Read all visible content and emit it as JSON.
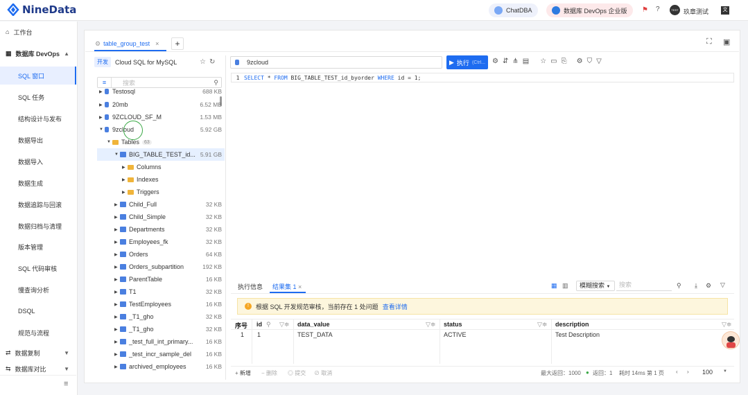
{
  "app": {
    "logo": "NineData",
    "chatdba": "ChatDBA",
    "devops_pill": "数据库 DevOps 企业版",
    "user_name": "玖章测试",
    "user_badge": "TEST"
  },
  "sidebar": {
    "items": [
      {
        "label": "工作台"
      },
      {
        "label": "数据库 DevOps"
      },
      {
        "label": "SQL 窗口"
      },
      {
        "label": "SQL 任务"
      },
      {
        "label": "结构设计与发布"
      },
      {
        "label": "数据导出"
      },
      {
        "label": "数据导入"
      },
      {
        "label": "数据生成"
      },
      {
        "label": "数据追踪与回滚"
      },
      {
        "label": "数据归档与清理"
      },
      {
        "label": "版本管理"
      },
      {
        "label": "SQL 代码审核"
      },
      {
        "label": "慢查询分析"
      },
      {
        "label": "DSQL"
      },
      {
        "label": "规范与流程"
      },
      {
        "label": "数据复制"
      },
      {
        "label": "数据库对比"
      }
    ]
  },
  "tab": {
    "label": "table_group_test",
    "close": "×",
    "add": "+"
  },
  "connection": {
    "env": "开发",
    "name": "Cloud SQL for MySQL"
  },
  "tree": {
    "search_placeholder": "搜索",
    "rows": [
      {
        "label": "Testosql",
        "size": "688 KB"
      },
      {
        "label": "20mb",
        "size": "6.52 MB"
      },
      {
        "label": "9ZCLOUD_SF_M",
        "size": "1.53 MB"
      },
      {
        "label": "9zcloud",
        "size": "5.92 GB"
      },
      {
        "label": "Tables",
        "badge": "63"
      },
      {
        "label": "BIG_TABLE_TEST_id...",
        "size": "5.91 GB"
      },
      {
        "label": "Columns"
      },
      {
        "label": "Indexes"
      },
      {
        "label": "Triggers"
      },
      {
        "label": "Child_Full",
        "size": "32 KB"
      },
      {
        "label": "Child_Simple",
        "size": "32 KB"
      },
      {
        "label": "Departments",
        "size": "32 KB"
      },
      {
        "label": "Employees_fk",
        "size": "32 KB"
      },
      {
        "label": "Orders",
        "size": "64 KB"
      },
      {
        "label": "Orders_subpartition",
        "size": "192 KB"
      },
      {
        "label": "ParentTable",
        "size": "16 KB"
      },
      {
        "label": "T1",
        "size": "32 KB"
      },
      {
        "label": "TestEmployees",
        "size": "16 KB"
      },
      {
        "label": "_T1_gho",
        "size": "32 KB"
      },
      {
        "label": "_T1_gho",
        "size": "32 KB"
      },
      {
        "label": "_test_full_int_primary...",
        "size": "16 KB"
      },
      {
        "label": "_test_incr_sample_del",
        "size": "16 KB"
      },
      {
        "label": "archived_employees",
        "size": "16 KB"
      }
    ]
  },
  "editor": {
    "db": "9zcloud",
    "run": "执行",
    "run_hint": "(Ctrl...",
    "line_no": "1",
    "sql": {
      "k1": "SELECT",
      "star": "*",
      "k2": "FROM",
      "table": "BIG_TABLE_TEST_id_byorder",
      "k3": "WHERE",
      "cond": "id = 1;"
    }
  },
  "results": {
    "tab_info": "执行信息",
    "tab_result": "结果集 1",
    "fuzzy": "模糊搜索",
    "search_placeholder": "搜索",
    "warning": "根据 SQL 开发规范审核，当前存在 1 处问题",
    "warning_link": "查看详情",
    "columns": [
      "序号",
      "id",
      "data_value",
      "status",
      "description"
    ],
    "rows": [
      [
        "1",
        "1",
        "TEST_DATA",
        "ACTIVE",
        "Test Description"
      ]
    ],
    "footer": {
      "add": "新增",
      "delete": "删除",
      "submit": "提交",
      "cancel": "取消",
      "max_return": "最大返回：1000",
      "returned": "返回：1",
      "elapsed": "耗时 14ms",
      "page": "第 1 页",
      "page_size": "100"
    }
  },
  "colors": {
    "accent": "#1e6cf0",
    "folder": "#f0b43a",
    "warning_bg": "#fdf6dd"
  }
}
